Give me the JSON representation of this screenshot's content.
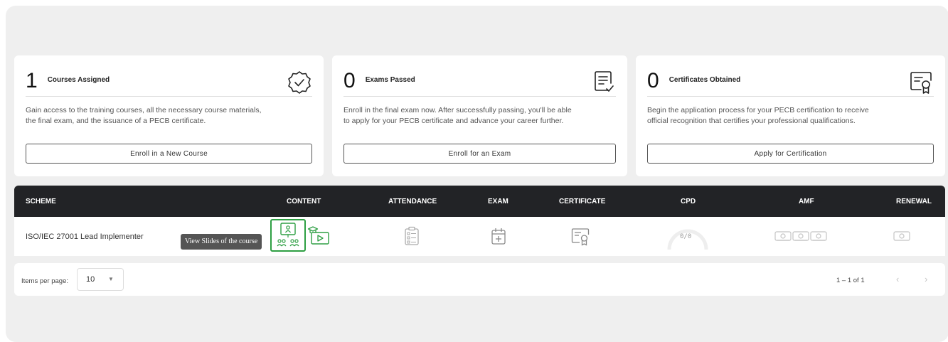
{
  "cards": [
    {
      "count": "1",
      "label": "Courses Assigned",
      "description_1": "Gain access to the training courses, all the necessary course materials,",
      "description_2": "the final exam, and the issuance of a PECB certificate.",
      "button": "Enroll in a New Course",
      "icon": "check-badge-icon"
    },
    {
      "count": "0",
      "label": "Exams Passed",
      "description_1": "Enroll in the final exam now. After successfully passing, you'll be able",
      "description_2": "to apply for your PECB certificate and advance your career further.",
      "button": "Enroll for an Exam",
      "icon": "exam-document-icon"
    },
    {
      "count": "0",
      "label": "Certificates Obtained",
      "description_1": "Begin the application process for your PECB certification to receive",
      "description_2": "official recognition that certifies your professional qualifications.",
      "button": "Apply for Certification",
      "icon": "certificate-icon"
    }
  ],
  "table": {
    "columns": [
      "SCHEME",
      "CONTENT",
      "ATTENDANCE",
      "EXAM",
      "CERTIFICATE",
      "CPD",
      "AMF",
      "RENEWAL"
    ],
    "rows": [
      {
        "scheme": "ISO/IEC 27001 Lead Implementer",
        "cpd": "0/0"
      }
    ],
    "tooltip": "View Slides of the course"
  },
  "pagination": {
    "items_per_page_label": "Items per page:",
    "items_per_page_value": "10",
    "range": "1 – 1 of 1"
  },
  "colors": {
    "accent_green": "#2e9f43",
    "header_bg": "#222326",
    "panel_bg": "#efefef"
  }
}
